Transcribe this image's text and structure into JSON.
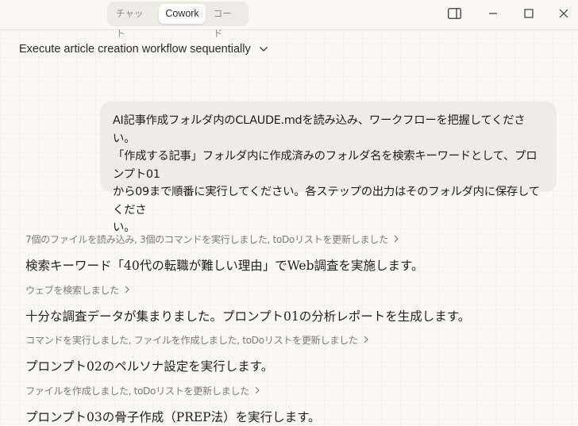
{
  "modes": [
    "チャット",
    "Cowork",
    "コード"
  ],
  "active_mode": "Cowork",
  "conversation_title": "Execute article creation workflow sequentially",
  "user_message_lines": [
    "AI記事作成フォルダ内のCLAUDE.mdを読み込み、ワークフローを把握してください。",
    "「作成する記事」フォルダ内に作成済みのフォルダ名を検索キーワードとして、プロンプト01",
    "から09まで順番に実行してください。各ステップの出力はそのフォルダ内に保存してくださ",
    "い。"
  ],
  "steps": [
    "7個のファイルを読み込み, 3個のコマンドを実行しました, toDoリストを更新しました",
    "ウェブを検索しました",
    "コマンドを実行しました, ファイルを作成しました, toDoリストを更新しました",
    "ファイルを作成しました, toDoリストを更新しました"
  ],
  "messages": [
    "検索キーワード「40代の転職が難しい理由」でWeb調査を実施します。",
    "十分な調査データが集まりました。プロンプト01の分析レポートを生成します。",
    "プロンプト02のペルソナ設定を実行します。",
    "プロンプト03の骨子作成（PREP法）を実行します。"
  ],
  "icons": {
    "sidebar_toggle": "sidebar-toggle-icon",
    "minimize": "minimize-icon",
    "maximize": "maximize-icon",
    "close": "close-icon",
    "chevron_down": "chevron-down-icon",
    "chevron_right": "chevron-right-icon"
  }
}
